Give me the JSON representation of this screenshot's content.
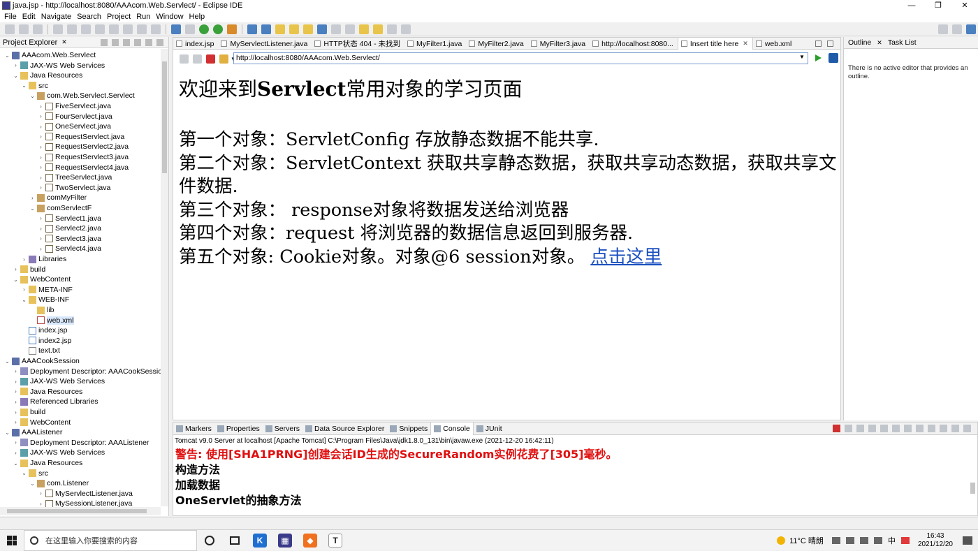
{
  "window": {
    "title": "java.jsp - http://localhost:8080/AAAcom.Web.Servlect/ - Eclipse IDE",
    "controls": [
      "—",
      "❐",
      "✕"
    ]
  },
  "menu": [
    "File",
    "Edit",
    "Navigate",
    "Search",
    "Project",
    "Run",
    "Window",
    "Help"
  ],
  "explorer": {
    "title": "Project Explorer",
    "tree": [
      {
        "label": "AAAcom.Web.Servlect",
        "indent": 0,
        "twisty": "open",
        "icon": "project"
      },
      {
        "label": "JAX-WS Web Services",
        "indent": 1,
        "twisty": "closed",
        "icon": "ws"
      },
      {
        "label": "Java Resources",
        "indent": 1,
        "twisty": "open",
        "icon": "folder"
      },
      {
        "label": "src",
        "indent": 2,
        "twisty": "open",
        "icon": "folder"
      },
      {
        "label": "com.Web.Servlect.Servlect",
        "indent": 3,
        "twisty": "open",
        "icon": "package"
      },
      {
        "label": "FiveServlect.java",
        "indent": 4,
        "twisty": "closed",
        "icon": "java"
      },
      {
        "label": "FourServlect.java",
        "indent": 4,
        "twisty": "closed",
        "icon": "java"
      },
      {
        "label": "OneServlect.java",
        "indent": 4,
        "twisty": "closed",
        "icon": "java"
      },
      {
        "label": "RequestServlect.java",
        "indent": 4,
        "twisty": "closed",
        "icon": "java"
      },
      {
        "label": "RequestServlect2.java",
        "indent": 4,
        "twisty": "closed",
        "icon": "java"
      },
      {
        "label": "RequestServlect3.java",
        "indent": 4,
        "twisty": "closed",
        "icon": "java"
      },
      {
        "label": "RequestServlect4.java",
        "indent": 4,
        "twisty": "closed",
        "icon": "java"
      },
      {
        "label": "TreeServlect.java",
        "indent": 4,
        "twisty": "closed",
        "icon": "java"
      },
      {
        "label": "TwoServlect.java",
        "indent": 4,
        "twisty": "closed",
        "icon": "java"
      },
      {
        "label": "comMyFilter",
        "indent": 3,
        "twisty": "closed",
        "icon": "package"
      },
      {
        "label": "comServlectF",
        "indent": 3,
        "twisty": "open",
        "icon": "package"
      },
      {
        "label": "Servlect1.java",
        "indent": 4,
        "twisty": "closed",
        "icon": "java"
      },
      {
        "label": "Servlect2.java",
        "indent": 4,
        "twisty": "closed",
        "icon": "java"
      },
      {
        "label": "Servlect3.java",
        "indent": 4,
        "twisty": "closed",
        "icon": "java"
      },
      {
        "label": "Servlect4.java",
        "indent": 4,
        "twisty": "closed",
        "icon": "java"
      },
      {
        "label": "Libraries",
        "indent": 2,
        "twisty": "closed",
        "icon": "lib"
      },
      {
        "label": "build",
        "indent": 1,
        "twisty": "closed",
        "icon": "folder"
      },
      {
        "label": "WebContent",
        "indent": 1,
        "twisty": "open",
        "icon": "folder"
      },
      {
        "label": "META-INF",
        "indent": 2,
        "twisty": "closed",
        "icon": "folder"
      },
      {
        "label": "WEB-INF",
        "indent": 2,
        "twisty": "open",
        "icon": "folder"
      },
      {
        "label": "lib",
        "indent": 3,
        "twisty": "none",
        "icon": "folder"
      },
      {
        "label": "web.xml",
        "indent": 3,
        "twisty": "none",
        "icon": "xml",
        "selected": true
      },
      {
        "label": "index.jsp",
        "indent": 2,
        "twisty": "none",
        "icon": "jsp"
      },
      {
        "label": "index2.jsp",
        "indent": 2,
        "twisty": "none",
        "icon": "jsp"
      },
      {
        "label": "text.txt",
        "indent": 2,
        "twisty": "none",
        "icon": "txt"
      },
      {
        "label": "AAACookSession",
        "indent": 0,
        "twisty": "open",
        "icon": "project"
      },
      {
        "label": "Deployment Descriptor: AAACookSession",
        "indent": 1,
        "twisty": "closed",
        "icon": "desc"
      },
      {
        "label": "JAX-WS Web Services",
        "indent": 1,
        "twisty": "closed",
        "icon": "ws"
      },
      {
        "label": "Java Resources",
        "indent": 1,
        "twisty": "closed",
        "icon": "folder"
      },
      {
        "label": "Referenced Libraries",
        "indent": 1,
        "twisty": "closed",
        "icon": "lib"
      },
      {
        "label": "build",
        "indent": 1,
        "twisty": "closed",
        "icon": "folder"
      },
      {
        "label": "WebContent",
        "indent": 1,
        "twisty": "closed",
        "icon": "folder"
      },
      {
        "label": "AAAListener",
        "indent": 0,
        "twisty": "open",
        "icon": "project"
      },
      {
        "label": "Deployment Descriptor: AAAListener",
        "indent": 1,
        "twisty": "closed",
        "icon": "desc"
      },
      {
        "label": "JAX-WS Web Services",
        "indent": 1,
        "twisty": "closed",
        "icon": "ws"
      },
      {
        "label": "Java Resources",
        "indent": 1,
        "twisty": "open",
        "icon": "folder"
      },
      {
        "label": "src",
        "indent": 2,
        "twisty": "open",
        "icon": "folder"
      },
      {
        "label": "com.Listener",
        "indent": 3,
        "twisty": "open",
        "icon": "package"
      },
      {
        "label": "MyServlectListener.java",
        "indent": 4,
        "twisty": "closed",
        "icon": "java"
      },
      {
        "label": "MySessionListener.java",
        "indent": 4,
        "twisty": "closed",
        "icon": "java"
      }
    ]
  },
  "editor": {
    "tabs": [
      {
        "label": "index.jsp"
      },
      {
        "label": "MyServlectListener.java"
      },
      {
        "label": "HTTP状态 404 - 未找到"
      },
      {
        "label": "MyFilter1.java"
      },
      {
        "label": "MyFilter2.java"
      },
      {
        "label": "MyFilter3.java"
      },
      {
        "label": "http://localhost:8080..."
      },
      {
        "label": "Insert title here",
        "active": true,
        "close": "✕"
      },
      {
        "label": "web.xml"
      }
    ],
    "url": "http://localhost:8080/AAAcom.Web.Servlect/"
  },
  "webpage": {
    "heading_pre": "欢迎来到",
    "heading_bold": "Servlect",
    "heading_post": "常用对象的学习页面",
    "lines": [
      "第一个对象：ServletConfig 存放静态数据不能共享.",
      "第二个对象：ServletContext 获取共享静态数据，获取共享动态数据，获取共享文件数据.",
      "第三个对象： response对象将数据发送给浏览器",
      "第四个对象：request 将浏览器的数据信息返回到服务器."
    ],
    "last_line": "第五个对象: Cookie对象。对象@6 session对象。",
    "link_text": "点击这里"
  },
  "outline": {
    "tabs": [
      "Outline",
      "Task List"
    ],
    "message": "There is no active editor that provides an outline."
  },
  "console": {
    "tabs": [
      {
        "label": "Markers"
      },
      {
        "label": "Properties"
      },
      {
        "label": "Servers"
      },
      {
        "label": "Data Source Explorer"
      },
      {
        "label": "Snippets"
      },
      {
        "label": "Console",
        "active": true
      },
      {
        "label": "JUnit"
      }
    ],
    "info": "Tomcat v9.0 Server at localhost [Apache Tomcat] C:\\Program Files\\Java\\jdk1.8.0_131\\bin\\javaw.exe  (2021-12-20 16:42:11)",
    "warning": "警告: 使用[SHA1PRNG]创建会话ID生成的SecureRandom实例花费了[305]毫秒。",
    "lines": [
      "构造方法",
      "加载数据",
      "OneServlet的抽象方法"
    ]
  },
  "taskbar": {
    "search_placeholder": "在这里输入你要搜索的内容",
    "weather": "11°C 晴朗",
    "ime": "中",
    "time": "16:43",
    "date": "2021/12/20",
    "apps": [
      {
        "glyph": "K",
        "color": "#1f6fd1"
      },
      {
        "glyph": "▦",
        "color": "#3a3a8a"
      },
      {
        "glyph": "◆",
        "color": "#f07020"
      },
      {
        "glyph": "T",
        "color": "#ffffff"
      }
    ]
  }
}
